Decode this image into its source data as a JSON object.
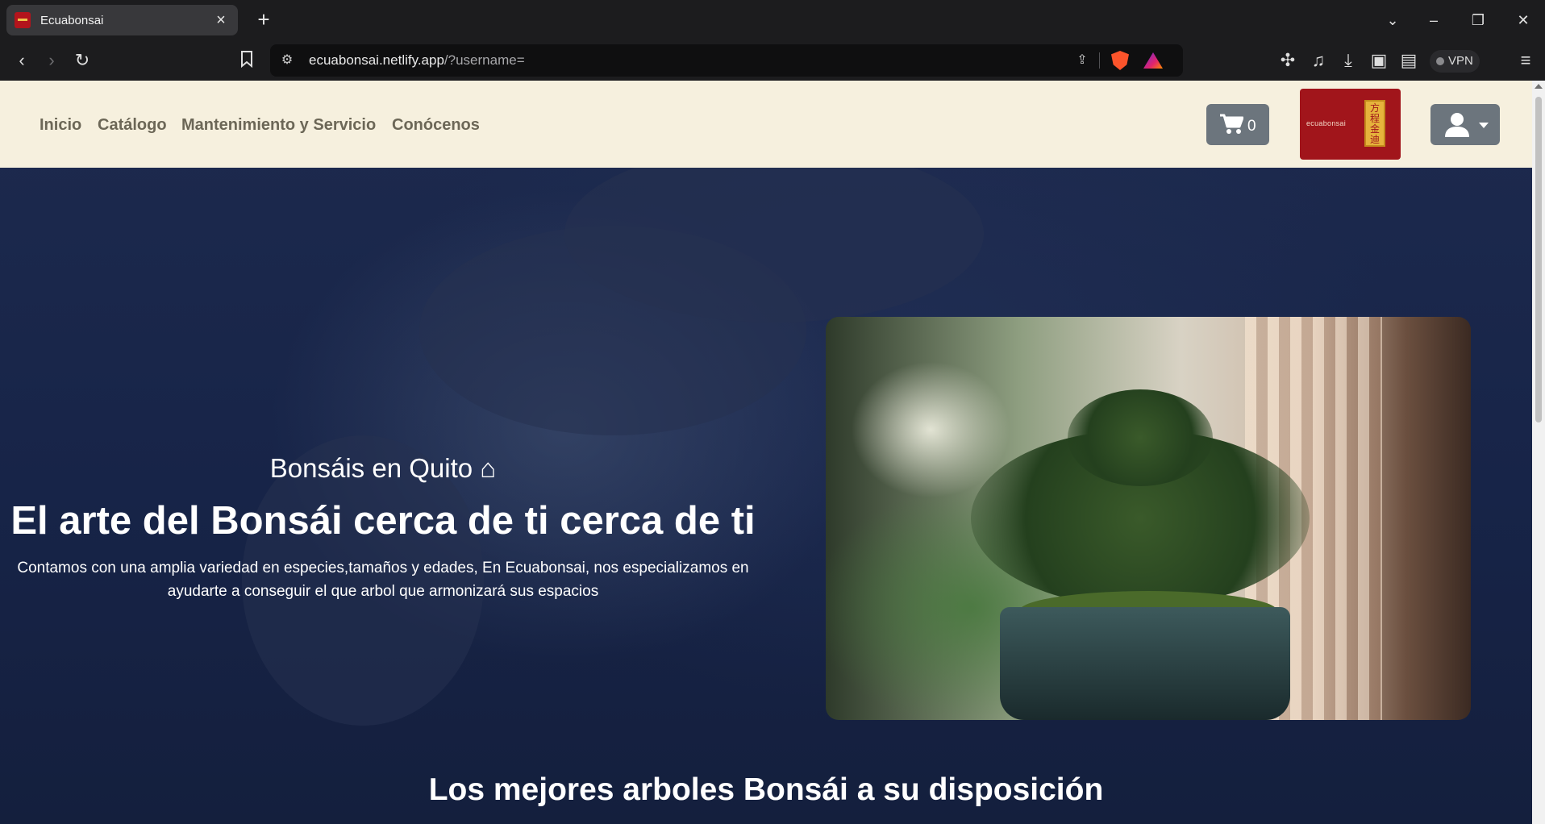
{
  "browser": {
    "tab_title": "Ecuabonsai",
    "url_host": "ecuabonsai.netlify.app",
    "url_path": "/?username=",
    "vpn_label": "VPN"
  },
  "navbar": {
    "links": [
      "Inicio",
      "Catálogo",
      "Mantenimiento y Servicio",
      "Conócenos"
    ],
    "cart_count": "0",
    "logo_text": "ecuabonsai",
    "logo_seal": "方程金迪"
  },
  "hero": {
    "subtitle": "Bonsáis en Quito ⌂",
    "title": "El arte del Bonsái cerca de ti cerca de ti",
    "text": "Contamos con una amplia variedad en especies,tamaños y edades, En Ecuabonsai, nos especializamos en ayudarte a conseguir el que arbol que armonizará sus espacios"
  },
  "section": {
    "title": "Los mejores arboles Bonsái a su disposición"
  },
  "colors": {
    "nav_bg": "#f6f0de",
    "hero_bg": "#172446",
    "button_gray": "#6c757d",
    "logo_red": "#a1151b"
  }
}
